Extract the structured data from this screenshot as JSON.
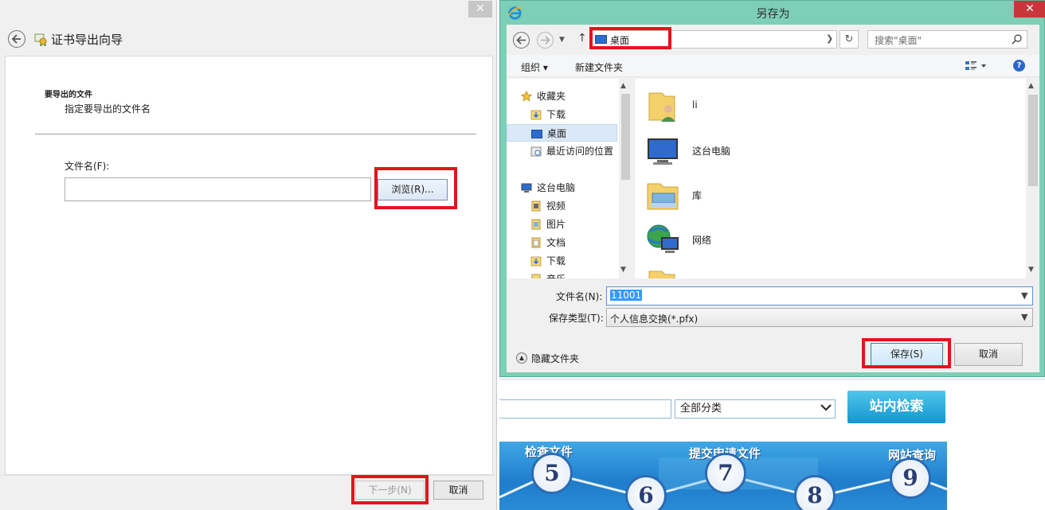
{
  "wizard": {
    "title": "证书导出向导",
    "close_label": "✕",
    "heading": "要导出的文件",
    "subheading": "指定要导出的文件名",
    "filename_label": "文件名(F):",
    "filename_value": "",
    "browse_label": "浏览(R)...",
    "next_label": "下一步(N)",
    "cancel_label": "取消"
  },
  "save_dialog": {
    "title": "另存为",
    "close_label": "✕",
    "address": "桌面",
    "search_placeholder": "搜索\"桌面\"",
    "toolbar": {
      "organize_label": "组织 ▾",
      "new_folder_label": "新建文件夹"
    },
    "nav": {
      "favorites_label": "收藏夹",
      "downloads_label": "下载",
      "desktop_label": "桌面",
      "recent_label": "最近访问的位置",
      "this_pc_label": "这台电脑",
      "videos_label": "视频",
      "pictures_label": "图片",
      "documents_label": "文档",
      "downloads2_label": "下载",
      "music_label": "音乐"
    },
    "files": [
      {
        "name": "li",
        "icon": "user-folder-icon"
      },
      {
        "name": "这台电脑",
        "icon": "computer-icon"
      },
      {
        "name": "库",
        "icon": "library-icon"
      },
      {
        "name": "网络",
        "icon": "network-icon"
      }
    ],
    "filename_label": "文件名(N):",
    "filename_value": "11001",
    "filetype_label": "保存类型(T):",
    "filetype_value": "个人信息交换(*.pfx)",
    "hide_folders_label": "隐藏文件夹",
    "save_label": "保存(S)",
    "cancel_label": "取消"
  },
  "webpage": {
    "category_value": "全部分类",
    "search_button_label": "站内检索",
    "steps": [
      {
        "label": "检查文件",
        "number": "5"
      },
      {
        "label": "",
        "number": "6"
      },
      {
        "label": "提交申请文件",
        "number": "7"
      },
      {
        "label": "",
        "number": "8"
      },
      {
        "label": "网站查询",
        "number": "9"
      }
    ]
  },
  "colors": {
    "highlight": "#e4141b",
    "dialog_frame": "#7dcfb6",
    "close_button": "#c7363b",
    "banner": "#1f7dcc"
  }
}
